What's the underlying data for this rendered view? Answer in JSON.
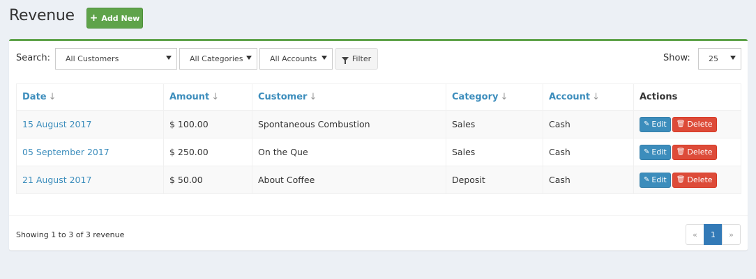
{
  "header": {
    "title": "Revenue",
    "add_new_label": "Add New"
  },
  "filters": {
    "search_label": "Search:",
    "customers_selected": "All Customers",
    "categories_selected": "All Categories",
    "accounts_selected": "All Accounts",
    "filter_label": "Filter",
    "show_label": "Show:",
    "show_selected": "25"
  },
  "table": {
    "headers": [
      "Date",
      "Amount",
      "Customer",
      "Category",
      "Account",
      "Actions"
    ],
    "rows": [
      {
        "date": "15 August 2017",
        "amount": "$ 100.00",
        "customer": "Spontaneous Combustion",
        "category": "Sales",
        "account": "Cash"
      },
      {
        "date": "05 September 2017",
        "amount": "$ 250.00",
        "customer": "On the Que",
        "category": "Sales",
        "account": "Cash"
      },
      {
        "date": "21 August 2017",
        "amount": "$ 50.00",
        "customer": "About Coffee",
        "category": "Deposit",
        "account": "Cash"
      }
    ],
    "edit_label": "Edit",
    "delete_label": "Delete"
  },
  "footer": {
    "showing_text": "Showing 1 to 3 of 3 revenue",
    "pagination": {
      "prev": "«",
      "current": "1",
      "next": "»"
    }
  },
  "colors": {
    "accent_green": "#5fa34a",
    "link_blue": "#3c8dbc",
    "danger_red": "#dd4b39",
    "page_bg": "#ecf0f5"
  },
  "icons": {
    "add": "plus-icon",
    "filter": "filter-icon",
    "edit": "edit-icon",
    "delete": "trash-icon",
    "sort": "sort-down-icon"
  }
}
